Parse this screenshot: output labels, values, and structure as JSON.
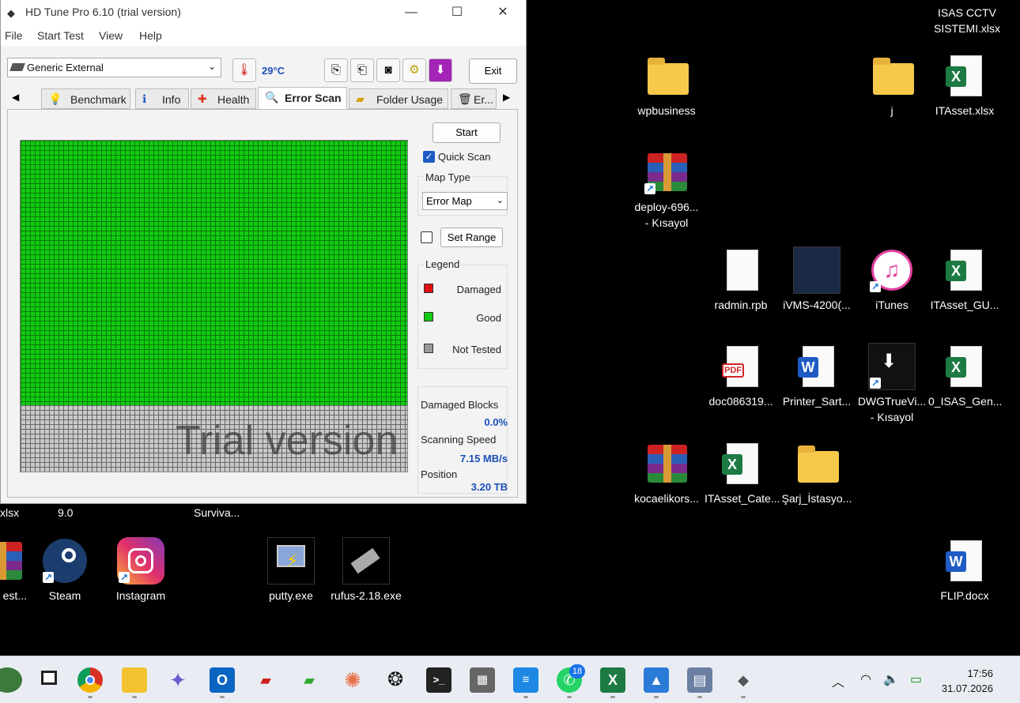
{
  "window": {
    "title": "HD Tune Pro 6.10 (trial version)",
    "menu": [
      "File",
      "Start Test",
      "View",
      "Help"
    ],
    "drive": "Generic External",
    "temperature": "29°C",
    "exit_label": "Exit",
    "tabs": [
      "Benchmark",
      "Info",
      "Health",
      "Error Scan",
      "Folder Usage",
      "Er..."
    ],
    "active_tab": "Error Scan",
    "start_label": "Start",
    "quick_scan_label": "Quick Scan",
    "quick_scan_checked": true,
    "map_type_label": "Map Type",
    "map_type_value": "Error Map",
    "set_range_label": "Set Range",
    "legend_label": "Legend",
    "legend": [
      {
        "label": "Damaged",
        "color": "#e01010"
      },
      {
        "label": "Good",
        "color": "#11cc11"
      },
      {
        "label": "Not Tested",
        "color": "#999999"
      }
    ],
    "watermark": "Trial version",
    "stats": {
      "damaged_label": "Damaged Blocks",
      "damaged_value": "0.0%",
      "speed_label": "Scanning Speed",
      "speed_value": "7.15 MB/s",
      "position_label": "Position",
      "position_value": "3.20 TB"
    },
    "scanned_fraction": 0.8
  },
  "desktop": {
    "top_right_text": "ISAS CCTV\nSISTEMI.xlsx",
    "icons": [
      {
        "label": "wpbusiness",
        "type": "folder"
      },
      {
        "label": "j",
        "type": "folder-mail"
      },
      {
        "label": "ITAsset.xlsx",
        "type": "excel"
      },
      {
        "label": "deploy-696...\n- Kısayol",
        "type": "winrar"
      },
      {
        "label": "radmin.rpb",
        "type": "file"
      },
      {
        "label": "iVMS-4200(...",
        "type": "app"
      },
      {
        "label": "iTunes",
        "type": "itunes"
      },
      {
        "label": "ITAsset_GU...",
        "type": "excel"
      },
      {
        "label": "doc086319...",
        "type": "pdf"
      },
      {
        "label": "Printer_Sart...",
        "type": "word"
      },
      {
        "label": "DWGTrueVi...\n- Kısayol",
        "type": "app"
      },
      {
        "label": "0_ISAS_Gen...",
        "type": "excel"
      },
      {
        "label": "kocaelikors...",
        "type": "winrar"
      },
      {
        "label": "ITAsset_Cate...",
        "type": "excel"
      },
      {
        "label": "Şarj_İstasyo...",
        "type": "folder"
      },
      {
        "label": "xlsx",
        "type": "partial"
      },
      {
        "label": "9.0",
        "type": "partial"
      },
      {
        "label": "Surviva...",
        "type": "partial"
      },
      {
        "label": "est...",
        "type": "winrar"
      },
      {
        "label": "Steam",
        "type": "steam"
      },
      {
        "label": "Instagram",
        "type": "instagram"
      },
      {
        "label": "putty.exe",
        "type": "putty"
      },
      {
        "label": "rufus-2.18.exe",
        "type": "rufus"
      },
      {
        "label": "FLIP.docx",
        "type": "word"
      }
    ]
  },
  "taskbar": {
    "whatsapp_badge": "18",
    "time": "17:56",
    "date": "31.07.2026"
  }
}
